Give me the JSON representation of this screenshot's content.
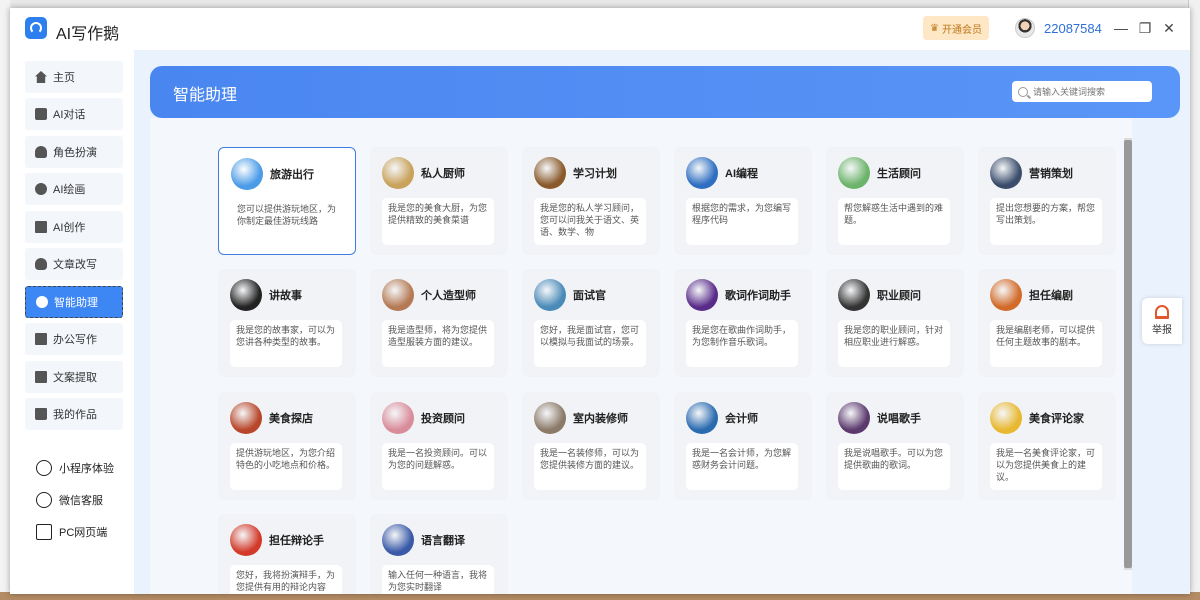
{
  "window": {
    "app_title": "AI写作鹅",
    "vip_label": "开通会员",
    "user_id": "22087584",
    "controls": [
      "minimize",
      "maximize",
      "close"
    ]
  },
  "sidebar": {
    "items": [
      {
        "label": "主页",
        "icon": "home-icon"
      },
      {
        "label": "AI对话",
        "icon": "chat-icon"
      },
      {
        "label": "角色扮演",
        "icon": "role-icon"
      },
      {
        "label": "AI绘画",
        "icon": "palette-icon"
      },
      {
        "label": "AI创作",
        "icon": "write-icon"
      },
      {
        "label": "文章改写",
        "icon": "bulb-icon"
      },
      {
        "label": "智能助理",
        "icon": "assistant-icon",
        "active": true
      },
      {
        "label": "办公写作",
        "icon": "office-icon"
      },
      {
        "label": "文案提取",
        "icon": "extract-icon"
      },
      {
        "label": "我的作品",
        "icon": "folder-icon"
      }
    ],
    "links": [
      {
        "label": "小程序体验",
        "icon": "miniprogram-icon"
      },
      {
        "label": "微信客服",
        "icon": "wechat-icon"
      },
      {
        "label": "PC网页端",
        "icon": "pc-icon"
      }
    ]
  },
  "header": {
    "title": "智能助理",
    "search_placeholder": "请输入关键词搜索"
  },
  "cards": [
    {
      "title": "旅游出行",
      "desc": "您可以提供游玩地区，为你制定最佳游玩线路",
      "color": "#4a9be8"
    },
    {
      "title": "私人厨师",
      "desc": "我是您的美食大厨，为您提供精致的美食菜谱",
      "color": "#c9a25b"
    },
    {
      "title": "学习计划",
      "desc": "我是您的私人学习顾问，您可以问我关于语文、英语、数学、物",
      "color": "#8a5a2b"
    },
    {
      "title": "AI编程",
      "desc": "根据您的需求，为您编写程序代码",
      "color": "#2e6fc2"
    },
    {
      "title": "生活顾问",
      "desc": "帮您解惑生活中遇到的难题。",
      "color": "#6cb46a"
    },
    {
      "title": "营销策划",
      "desc": "提出您想要的方案，帮您写出策划。",
      "color": "#3a4d6b"
    },
    {
      "title": "讲故事",
      "desc": "我是您的故事家，可以为您讲各种类型的故事。",
      "color": "#222222"
    },
    {
      "title": "个人造型师",
      "desc": "我是造型师，将为您提供造型服装方面的建议。",
      "color": "#b57a55"
    },
    {
      "title": "面试官",
      "desc": "您好，我是面试官，您可以模拟与我面试的场景。",
      "color": "#4b8bb8"
    },
    {
      "title": "歌词作词助手",
      "desc": "我是您在歌曲作词助手，为您制作音乐歌词。",
      "color": "#5a2c8a"
    },
    {
      "title": "职业顾问",
      "desc": "我是您的职业顾问，针对相应职业进行解惑。",
      "color": "#333333"
    },
    {
      "title": "担任编剧",
      "desc": "我是编剧老师，可以提供任何主题故事的剧本。",
      "color": "#d26b2a"
    },
    {
      "title": "美食探店",
      "desc": "提供游玩地区，为您介绍特色的小吃地点和价格。",
      "color": "#b8462a"
    },
    {
      "title": "投资顾问",
      "desc": "我是一名投资顾问。可以为您的问题解惑。",
      "color": "#d98c9a"
    },
    {
      "title": "室内装修师",
      "desc": "我是一名装修师，可以为您提供装修方面的建议。",
      "color": "#8c7a68"
    },
    {
      "title": "会计师",
      "desc": "我是一名会计师，为您解惑财务会计问题。",
      "color": "#2a6bb0"
    },
    {
      "title": "说唱歌手",
      "desc": "我是说唱歌手。可以为您提供歌曲的歌词。",
      "color": "#5c3a6e"
    },
    {
      "title": "美食评论家",
      "desc": "我是一名美食评论家，可以为您提供美食上的建议。",
      "color": "#e8b830"
    },
    {
      "title": "担任辩论手",
      "desc": "您好，我将扮演辩手，为您提供有用的辩论内容",
      "color": "#d23a2a"
    },
    {
      "title": "语言翻译",
      "desc": "输入任何一种语言，我将为您实时翻译",
      "color": "#3a5aa8"
    }
  ],
  "report": {
    "label": "举报"
  }
}
